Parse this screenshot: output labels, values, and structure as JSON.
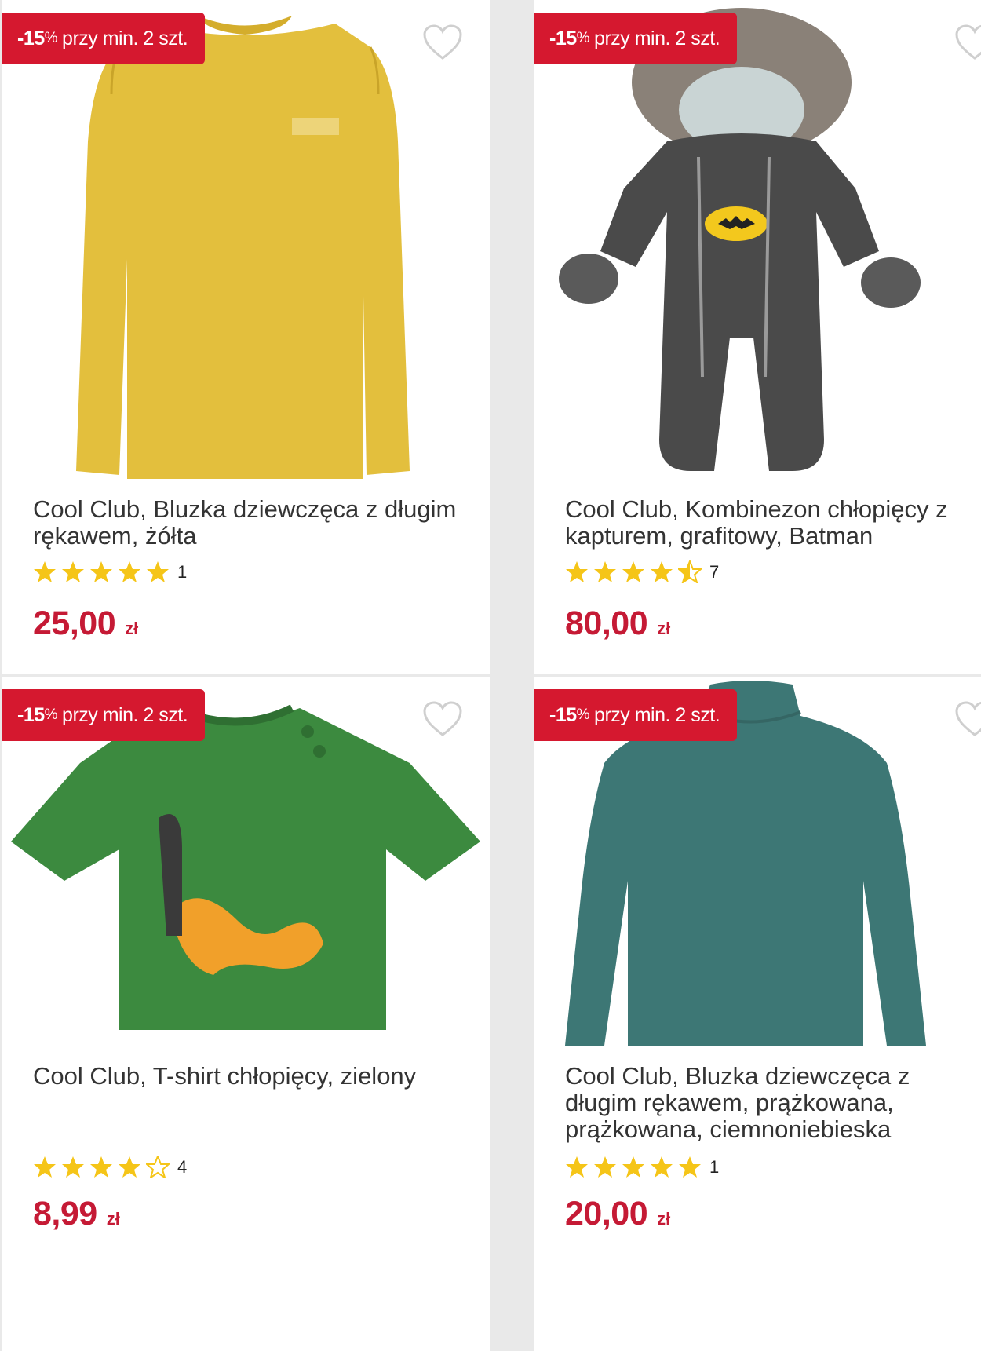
{
  "products": [
    {
      "badge": {
        "percent": "-15",
        "percent_sign": "%",
        "text": "przy min. 2 szt."
      },
      "title": "Cool Club, Bluzka dziewczęca z długim rękawem, żółta",
      "stars": 5,
      "rating_count": "1",
      "price": "25,00",
      "currency": "zł",
      "image_color": "#e3bf3d"
    },
    {
      "badge": {
        "percent": "-15",
        "percent_sign": "%",
        "text": "przy min. 2 szt."
      },
      "title": "Cool Club, Kombinezon chłopięcy z kapturem, grafitowy, Batman",
      "stars": 4.5,
      "rating_count": "7",
      "price": "80,00",
      "currency": "zł",
      "image_color": "#4a4a4a"
    },
    {
      "badge": {
        "percent": "-15",
        "percent_sign": "%",
        "text": "przy min. 2 szt."
      },
      "title": "Cool Club, T-shirt chłopięcy, zielony",
      "stars": 4,
      "rating_count": "4",
      "price": "8,99",
      "currency": "zł",
      "image_color": "#3c8a3f"
    },
    {
      "badge": {
        "percent": "-15",
        "percent_sign": "%",
        "text": "przy min. 2 szt."
      },
      "title": "Cool Club, Bluzka dziewczęca z długim rękawem, prążkowana, prążkowana, ciemnoniebieska",
      "stars": 5,
      "rating_count": "1",
      "price": "20,00",
      "currency": "zł",
      "image_color": "#3d7775"
    }
  ],
  "colors": {
    "badge_red": "#d5182f",
    "price_red": "#c51a35",
    "star_yellow": "#f5c518"
  }
}
